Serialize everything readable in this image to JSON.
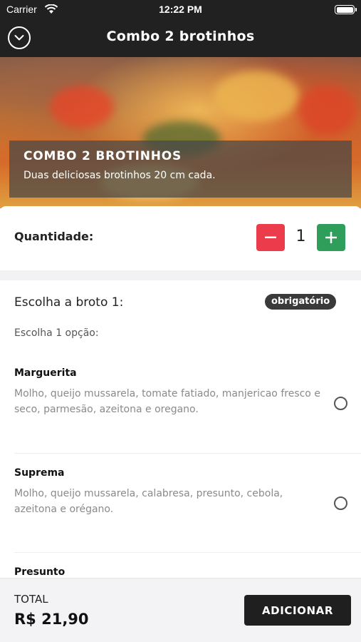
{
  "status_bar": {
    "carrier": "Carrier",
    "time": "12:22 PM"
  },
  "nav": {
    "title": "Combo 2 brotinhos",
    "back_icon": "chevron-down-icon"
  },
  "hero": {
    "title": "COMBO 2 BROTINHOS",
    "description": "Duas deliciosas brotinhos 20 cm cada."
  },
  "quantity": {
    "label": "Quantidade:",
    "value": "1",
    "minus_color": "#ec3b4a",
    "plus_color": "#2f9e5a"
  },
  "choice": {
    "title": "Escolha a broto 1:",
    "badge": "obrigatório",
    "subtitle": "Escolha 1 opção:",
    "options": [
      {
        "name": "Marguerita",
        "description": "Molho, queijo mussarela, tomate fatiado, manjericao fresco e seco, parmesão, azeitona e oregano."
      },
      {
        "name": "Suprema",
        "description": "Molho, queijo mussarela, calabresa, presunto, cebola, azeitona e orégano."
      },
      {
        "name": "Presunto",
        "description": ""
      }
    ]
  },
  "footer": {
    "total_label": "TOTAL",
    "total_value": "R$ 21,90",
    "add_label": "ADICIONAR"
  }
}
